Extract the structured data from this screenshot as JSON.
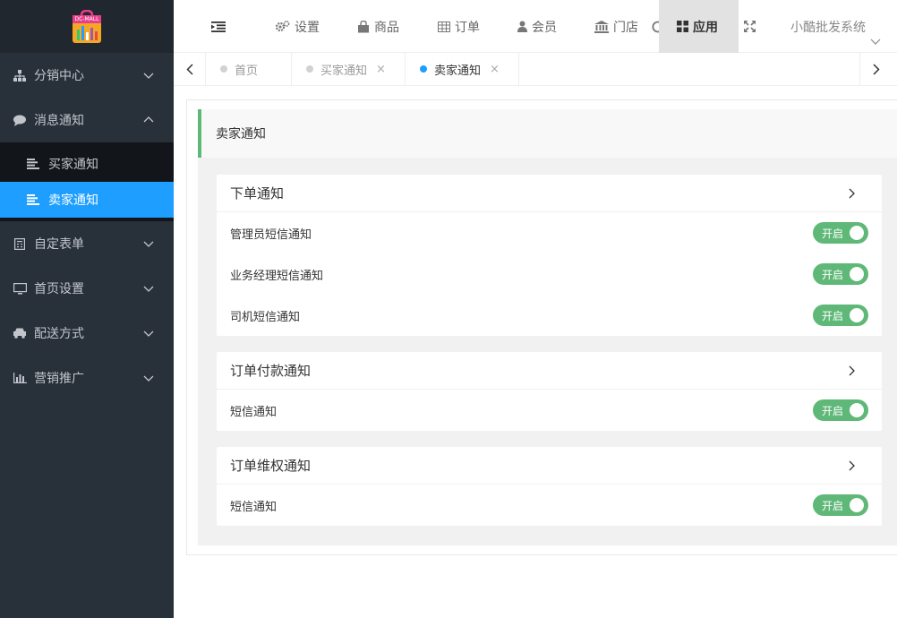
{
  "logo": {
    "text": "DC-MALL"
  },
  "sidebar": {
    "items": [
      {
        "label": "分销中心",
        "icon": "sitemap-icon",
        "expanded": false
      },
      {
        "label": "消息通知",
        "icon": "comment-icon",
        "expanded": true,
        "children": [
          {
            "label": "买家通知",
            "active": false
          },
          {
            "label": "卖家通知",
            "active": true
          }
        ]
      },
      {
        "label": "自定表单",
        "icon": "form-icon",
        "expanded": false
      },
      {
        "label": "首页设置",
        "icon": "monitor-icon",
        "expanded": false
      },
      {
        "label": "配送方式",
        "icon": "car-icon",
        "expanded": false
      },
      {
        "label": "营销推广",
        "icon": "bar-chart-icon",
        "expanded": false
      }
    ]
  },
  "header": {
    "nav": [
      {
        "label": "设置",
        "icon": "gears-icon"
      },
      {
        "label": "商品",
        "icon": "shopping-bag-icon"
      },
      {
        "label": "订单",
        "icon": "table-icon"
      },
      {
        "label": "会员",
        "icon": "user-icon"
      },
      {
        "label": "门店",
        "icon": "bank-icon"
      },
      {
        "label": "应用",
        "icon": "grid-icon",
        "active": true
      }
    ],
    "system_name": "小酷批发系统"
  },
  "tabs": [
    {
      "label": "首页",
      "closable": false,
      "active": false
    },
    {
      "label": "买家通知",
      "closable": true,
      "active": false
    },
    {
      "label": "卖家通知",
      "closable": true,
      "active": true
    }
  ],
  "tab_close_glyph": "×",
  "panel_title": "卖家通知",
  "cards": [
    {
      "title": "下单通知",
      "rows": [
        {
          "label": "管理员短信通知",
          "switch": "开启"
        },
        {
          "label": "业务经理短信通知",
          "switch": "开启"
        },
        {
          "label": "司机短信通知",
          "switch": "开启"
        }
      ]
    },
    {
      "title": "订单付款通知",
      "rows": [
        {
          "label": "短信通知",
          "switch": "开启"
        }
      ]
    },
    {
      "title": "订单维权通知",
      "rows": [
        {
          "label": "短信通知",
          "switch": "开启"
        }
      ]
    }
  ],
  "colors": {
    "sidebar_bg": "#28303a",
    "active_blue": "#1e9fff",
    "switch_green": "#5fb878"
  }
}
